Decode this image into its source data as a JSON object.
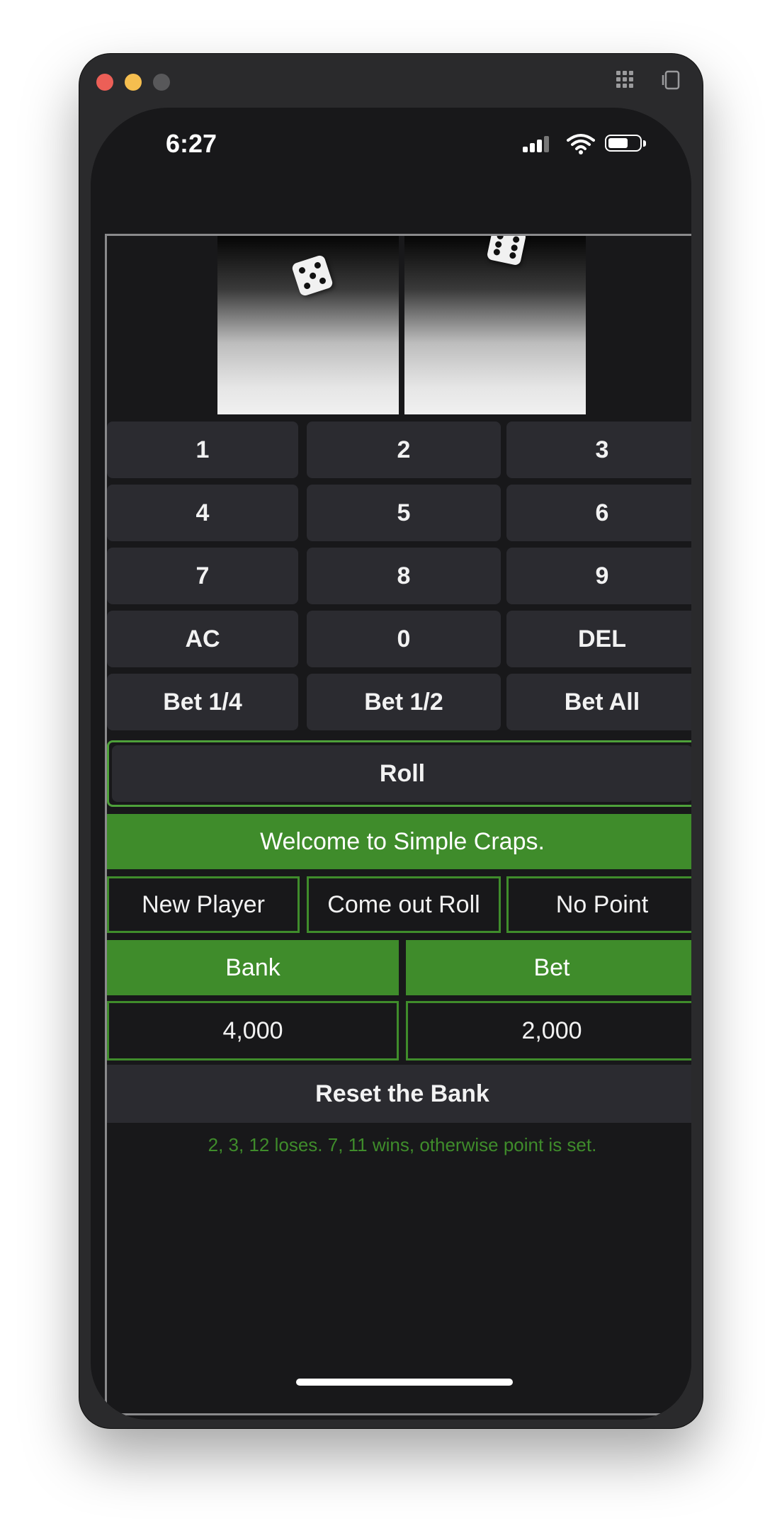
{
  "status_bar": {
    "time": "6:27"
  },
  "window_icons": {
    "grid": "grid-icon",
    "rotate": "rotate-device-icon"
  },
  "keypad": {
    "rows": [
      [
        "1",
        "2",
        "3"
      ],
      [
        "4",
        "5",
        "6"
      ],
      [
        "7",
        "8",
        "9"
      ],
      [
        "AC",
        "0",
        "DEL"
      ],
      [
        "Bet 1/4",
        "Bet 1/2",
        "Bet All"
      ]
    ]
  },
  "roll_label": "Roll",
  "message": "Welcome to Simple Craps.",
  "status": {
    "player": "New Player",
    "phase": "Come out Roll",
    "point": "No Point"
  },
  "bank": {
    "label": "Bank",
    "value": "4,000"
  },
  "bet": {
    "label": "Bet",
    "value": "2,000"
  },
  "reset_label": "Reset the Bank",
  "hint": "2, 3, 12 loses. 7, 11 wins, otherwise point is set.",
  "colors": {
    "accent_green": "#3f8c2b",
    "key_bg": "#2b2b30",
    "app_bg": "#18181a"
  }
}
